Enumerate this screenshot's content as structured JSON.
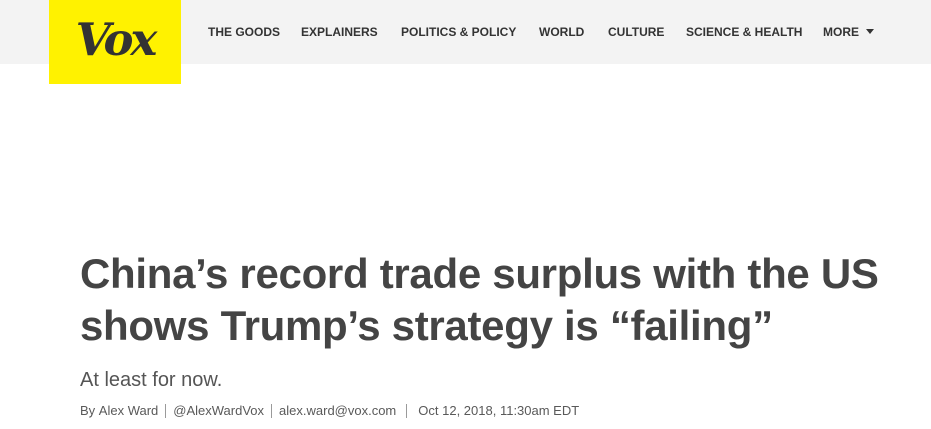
{
  "brand": {
    "logo_text": "Vox",
    "logo_color": "#fff200"
  },
  "nav": {
    "items": [
      {
        "label": "THE GOODS"
      },
      {
        "label": "EXPLAINERS"
      },
      {
        "label": "POLITICS & POLICY"
      },
      {
        "label": "WORLD"
      },
      {
        "label": "CULTURE"
      },
      {
        "label": "SCIENCE & HEALTH"
      },
      {
        "label": "MORE",
        "icon": "chevron-down-icon"
      }
    ]
  },
  "article": {
    "headline_line1": "China’s record trade surplus with the US",
    "headline_line2": "shows Trump’s strategy is “failing”",
    "dek": "At least for now.",
    "byline": {
      "prefix": "By",
      "author": "Alex Ward",
      "twitter": "@AlexWardVox",
      "email": "alex.ward@vox.com",
      "date": "Oct 12, 2018, 11:30am EDT"
    }
  }
}
